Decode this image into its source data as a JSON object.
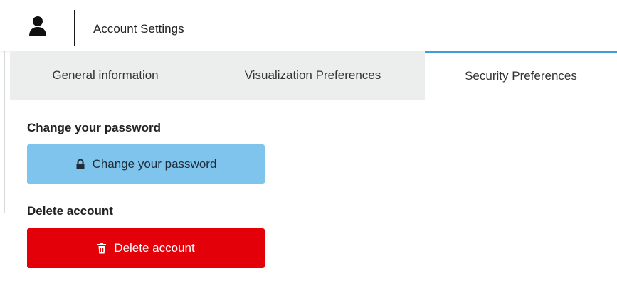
{
  "header": {
    "title": "Account Settings",
    "icon": "user-icon"
  },
  "tabs": [
    {
      "label": "General information",
      "active": false
    },
    {
      "label": "Visualization Preferences",
      "active": false
    },
    {
      "label": "Security Preferences",
      "active": true
    }
  ],
  "security": {
    "password_heading": "Change your password",
    "password_button": {
      "label": "Change your password",
      "icon": "lock-icon",
      "color": "#7fc4ec"
    },
    "delete_heading": "Delete account",
    "delete_button": {
      "label": "Delete account",
      "icon": "trash-icon",
      "color": "#e40008"
    }
  },
  "colors": {
    "active_tab_accent": "#3b9fdd",
    "tab_bar_bg": "#eceded"
  }
}
